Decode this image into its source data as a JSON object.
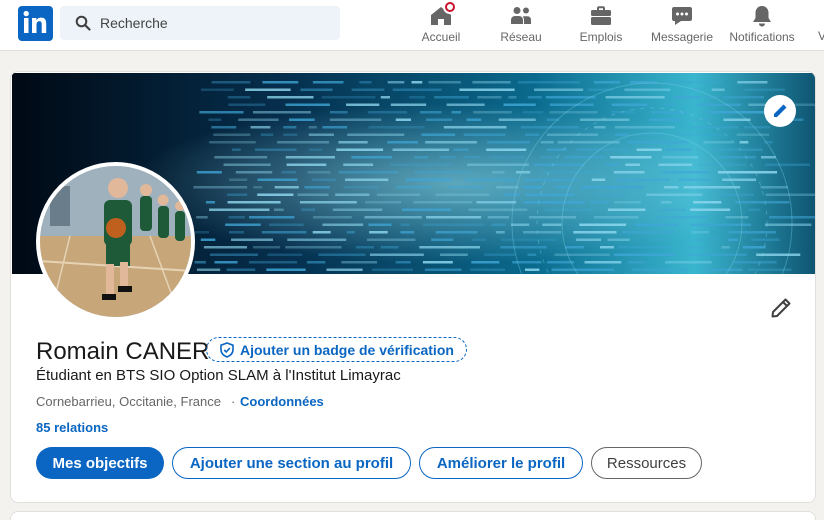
{
  "nav": {
    "search_placeholder": "Recherche",
    "items": [
      {
        "label": "Accueil",
        "icon": "home-icon",
        "has_badge": true
      },
      {
        "label": "Réseau",
        "icon": "network-icon"
      },
      {
        "label": "Emplois",
        "icon": "briefcase-icon"
      },
      {
        "label": "Messagerie",
        "icon": "messaging-icon"
      },
      {
        "label": "Notifications",
        "icon": "bell-icon"
      }
    ],
    "overflow_label": "V"
  },
  "profile": {
    "name": "Romain CANER",
    "verify_badge_label": "Ajouter un badge de vérification",
    "headline": "Étudiant en BTS SIO Option SLAM à l'Institut Limayrac",
    "location": "Cornebarrieu, Occitanie, France",
    "separator": "·",
    "contact_link": "Coordonnées",
    "relations": "85 relations"
  },
  "actions": {
    "primary": "Mes objectifs",
    "add_section": "Ajouter une section au profil",
    "improve": "Améliorer le profil",
    "resources": "Ressources"
  },
  "colors": {
    "brand": "#0a66c2",
    "notification_badge": "#cb112d",
    "page_bg": "#f4f2ee"
  }
}
